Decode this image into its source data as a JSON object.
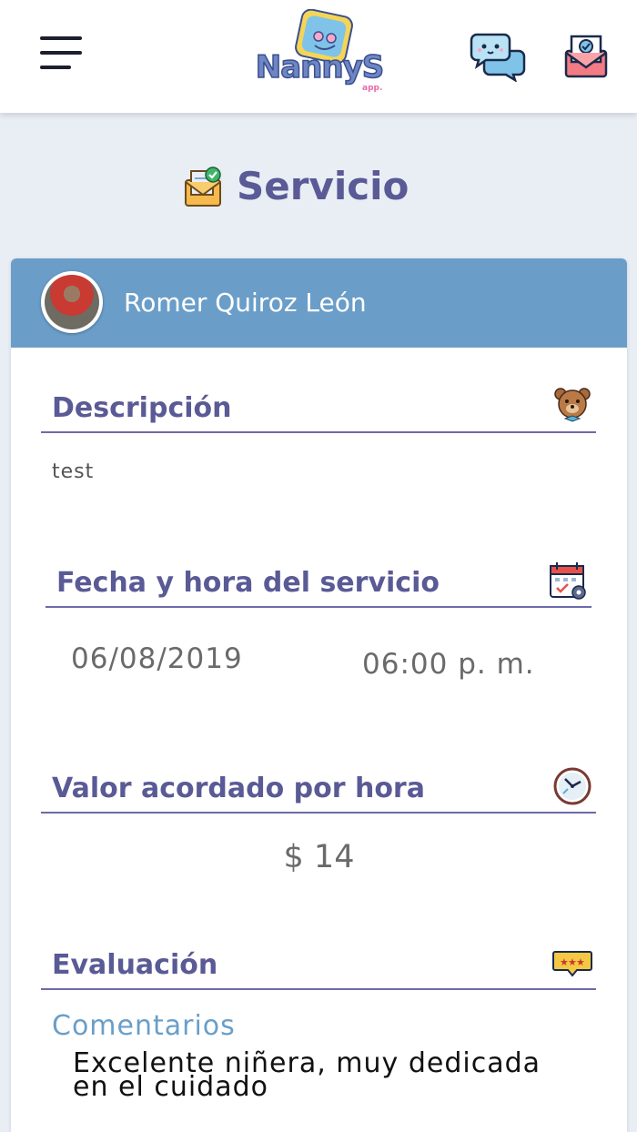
{
  "header": {
    "menu_icon": "hamburger-menu-icon",
    "logo_text": "NannyS",
    "logo_sub": "app.",
    "chat_icon": "chat-bubbles-icon",
    "mail_icon": "mail-check-icon"
  },
  "page": {
    "title": "Servicio",
    "title_icon": "envelope-check-icon"
  },
  "card": {
    "user_name": "Romer Quiroz León",
    "header_color": "#6a9ec8",
    "sections": {
      "description": {
        "label": "Descripción",
        "icon": "teddy-bear-icon",
        "value": "test"
      },
      "datetime": {
        "label": "Fecha y hora del servicio",
        "icon": "calendar-icon",
        "date": "06/08/2019",
        "time": "06:00 p. m."
      },
      "rate": {
        "label": "Valor acordado por hora",
        "icon": "clock-icon",
        "value": "$ 14"
      },
      "evaluation": {
        "label": "Evaluación",
        "icon": "rating-stars-icon",
        "comments_label": "Comentarios",
        "comments": "Excelente niñera, muy dedicada en el cuidado"
      }
    }
  },
  "colors": {
    "background": "#e9eef4",
    "title": "#5a5a96",
    "accent": "#6a9ec8",
    "divider": "#6e6aa8"
  }
}
